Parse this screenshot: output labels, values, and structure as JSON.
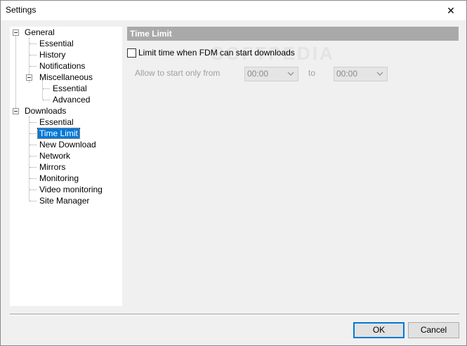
{
  "window": {
    "title": "Settings",
    "close_glyph": "✕"
  },
  "tree": {
    "general": {
      "label": "General",
      "essential": "Essential",
      "history": "History",
      "notifications": "Notifications",
      "miscellaneous": {
        "label": "Miscellaneous",
        "essential": "Essential",
        "advanced": "Advanced"
      }
    },
    "downloads": {
      "label": "Downloads",
      "essential": "Essential",
      "time_limit": "Time Limit",
      "new_download": "New Download",
      "network": "Network",
      "mirrors": "Mirrors",
      "monitoring": "Monitoring",
      "video_monitoring": "Video monitoring",
      "site_manager": "Site Manager"
    },
    "selected": "Time Limit"
  },
  "panel": {
    "header": "Time Limit",
    "watermark": "SOFTPEDIA",
    "limit_checkbox_label": "Limit time when FDM can start downloads",
    "limit_checked": false,
    "allow_label": "Allow to start only from",
    "from_value": "00:00",
    "to_label": "to",
    "to_value": "00:00"
  },
  "buttons": {
    "ok": "OK",
    "cancel": "Cancel"
  },
  "colors": {
    "selection": "#0078d7",
    "header_bg": "#a9a9a9"
  }
}
